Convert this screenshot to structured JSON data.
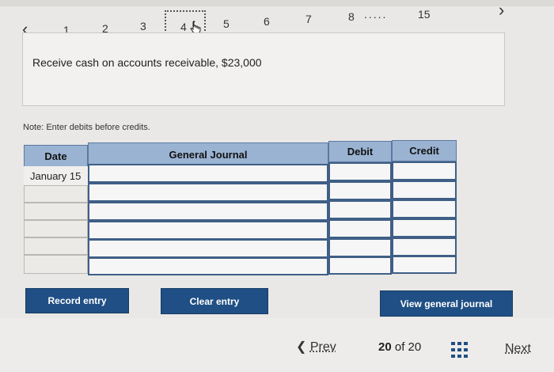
{
  "nav": {
    "prev_icon": "chevron-left-icon",
    "next_icon": "chevron-right-icon",
    "steps": [
      "1",
      "2",
      "3",
      "4",
      "5",
      "6",
      "7",
      "8",
      "15"
    ],
    "active_step": "4",
    "ellipsis": "....."
  },
  "question": {
    "text": "Receive cash on accounts receivable, $23,000"
  },
  "note": "Note: Enter debits before credits.",
  "journal": {
    "headers": {
      "date": "Date",
      "general_journal": "General Journal",
      "debit": "Debit",
      "credit": "Credit"
    },
    "rows": [
      {
        "date": "January 15"
      },
      {
        "date": ""
      },
      {
        "date": ""
      },
      {
        "date": ""
      },
      {
        "date": ""
      },
      {
        "date": ""
      }
    ]
  },
  "buttons": {
    "record": "Record entry",
    "clear": "Clear entry",
    "view": "View general journal"
  },
  "pager": {
    "prev_label": "Prev",
    "current": "20",
    "of_label": "of",
    "total": "20",
    "next_label": "Next"
  },
  "colors": {
    "header_bg": "#9ab3d2",
    "button_bg": "#1f4f84"
  }
}
